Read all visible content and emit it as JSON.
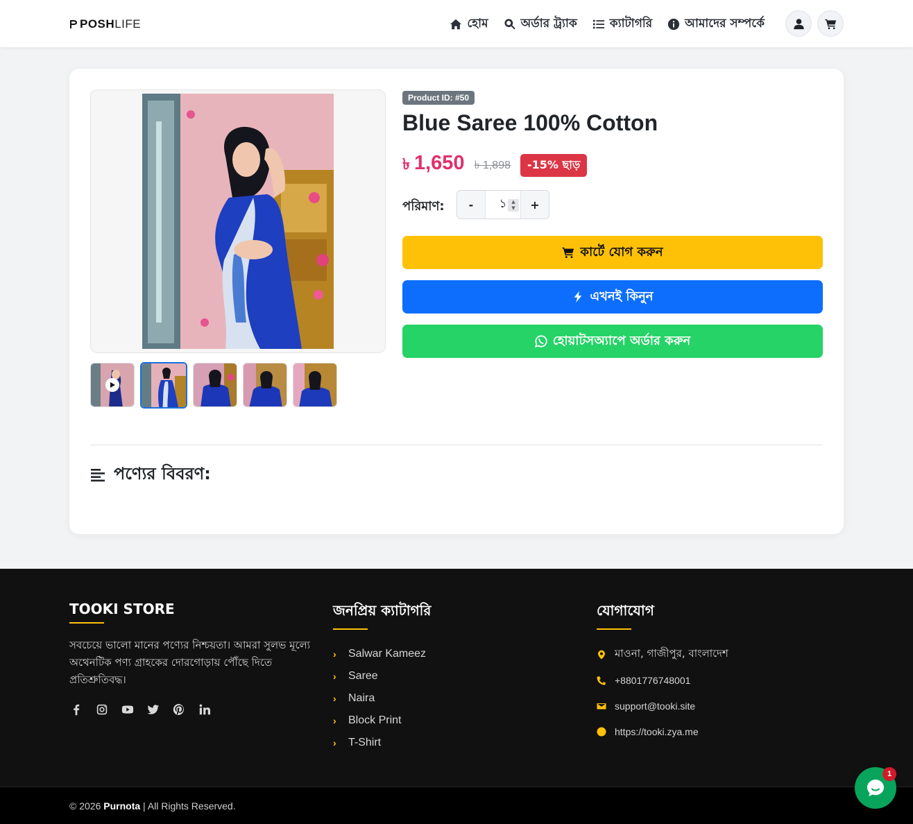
{
  "header": {
    "logo": {
      "part1": "POSH",
      "part2": "LIFE"
    },
    "nav": [
      {
        "label": "হোম",
        "icon": "home-icon"
      },
      {
        "label": "অর্ডার ট্র্যাক",
        "icon": "search-icon"
      },
      {
        "label": "ক্যাটাগরি",
        "icon": "list-icon"
      },
      {
        "label": "আমাদের সম্পর্কে",
        "icon": "info-icon"
      }
    ],
    "actions": [
      "user-icon",
      "cart-icon"
    ]
  },
  "product": {
    "id_badge": "Product ID: #50",
    "title": "Blue Saree 100% Cotton",
    "currency": "৳",
    "price": "1,650",
    "old_price": "৳ 1,898",
    "discount": "-15% ছাড়",
    "qty_label": "পরিমাণ:",
    "qty_value": "১",
    "qty_minus": "-",
    "qty_plus": "+",
    "thumbnails": [
      {
        "type": "video",
        "active": false
      },
      {
        "type": "image",
        "active": true
      },
      {
        "type": "image",
        "active": false
      },
      {
        "type": "image",
        "active": false
      },
      {
        "type": "image",
        "active": false
      }
    ],
    "buttons": {
      "add_to_cart": "কার্টে যোগ করুন",
      "buy_now": "এখনই কিনুন",
      "whatsapp": "হোয়াটসঅ্যাপে অর্ডার করুন"
    },
    "description_heading": "পণ্যের বিবরণ:"
  },
  "footer": {
    "store": {
      "title": "TOOKI STORE",
      "about": "সবচেয়ে ভালো মানের পণ্যের নিশ্চয়তা। আমরা সুলভ মূল্যে অথেনটিক পণ্য গ্রাহকের দোরগোড়ায় পৌঁছে দিতে প্রতিশ্রুতিবদ্ধ।",
      "socials": [
        "facebook-icon",
        "instagram-icon",
        "youtube-icon",
        "twitter-icon",
        "pinterest-icon",
        "linkedin-icon"
      ]
    },
    "categories": {
      "title": "জনপ্রিয় ক্যাটাগরি",
      "items": [
        "Salwar Kameez",
        "Saree",
        "Naira",
        "Block Print",
        "T-Shirt"
      ]
    },
    "contact": {
      "title": "যোগাযোগ",
      "address": "মাওনা, গাজীপুর, বাংলাদেশ",
      "phone": "+8801776748001",
      "email": "support@tooki.site",
      "website": "https://tooki.zya.me"
    },
    "copyright": {
      "prefix": "© 2026 ",
      "brand": "Purnota",
      "suffix": " | All Rights Reserved."
    }
  },
  "chat": {
    "badge": "1"
  },
  "colors": {
    "accent": "#ffc107",
    "price": "#e0306b",
    "primary": "#0d6efd",
    "whatsapp": "#25d366",
    "discount": "#dc3545"
  }
}
